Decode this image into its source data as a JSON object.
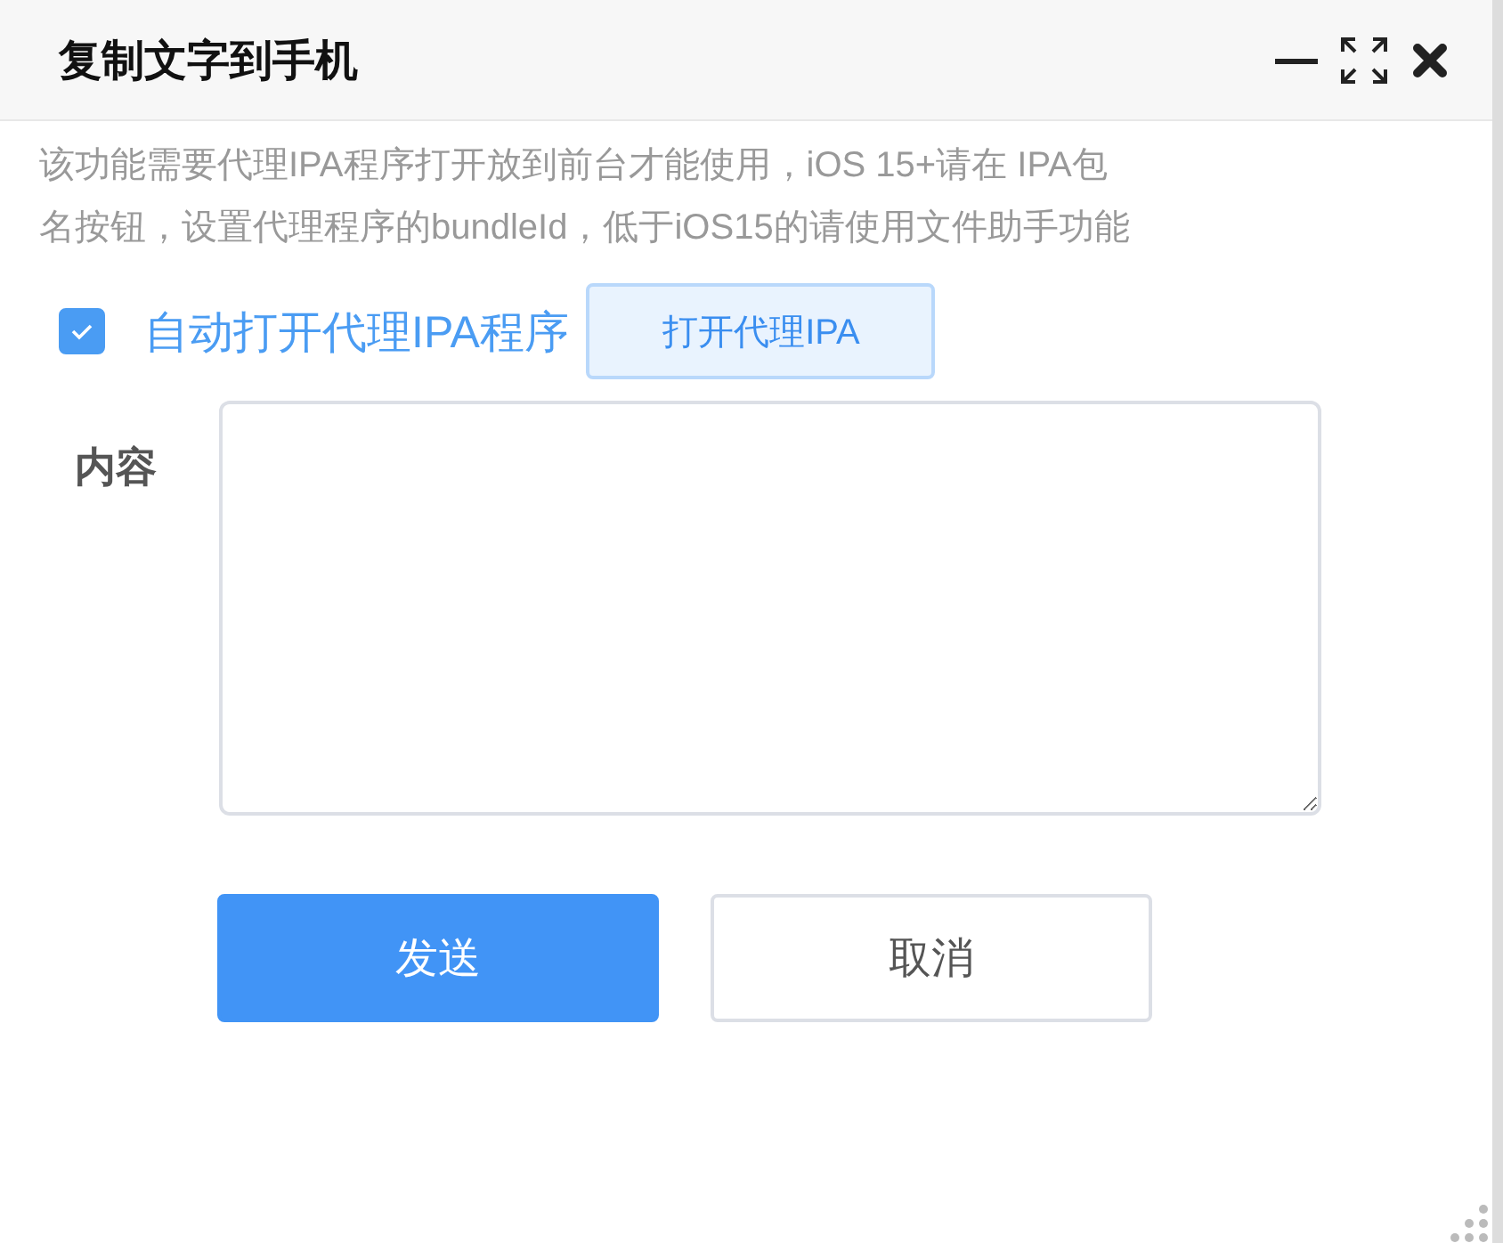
{
  "window": {
    "title": "复制文字到手机"
  },
  "description": "该功能需要代理IPA程序打开放到前台才能使用，iOS 15+请在 IPA包名按钮，设置代理程序的bundleId，低于iOS15的请使用文件助手功能",
  "auto_open": {
    "label": "自动打开代理IPA程序",
    "checked": true
  },
  "open_button": "打开代理IPA",
  "content": {
    "label": "内容"
  },
  "buttons": [
    {
      "label": "发送",
      "kind": "primary"
    },
    {
      "label": "取消",
      "kind": "default"
    }
  ]
}
